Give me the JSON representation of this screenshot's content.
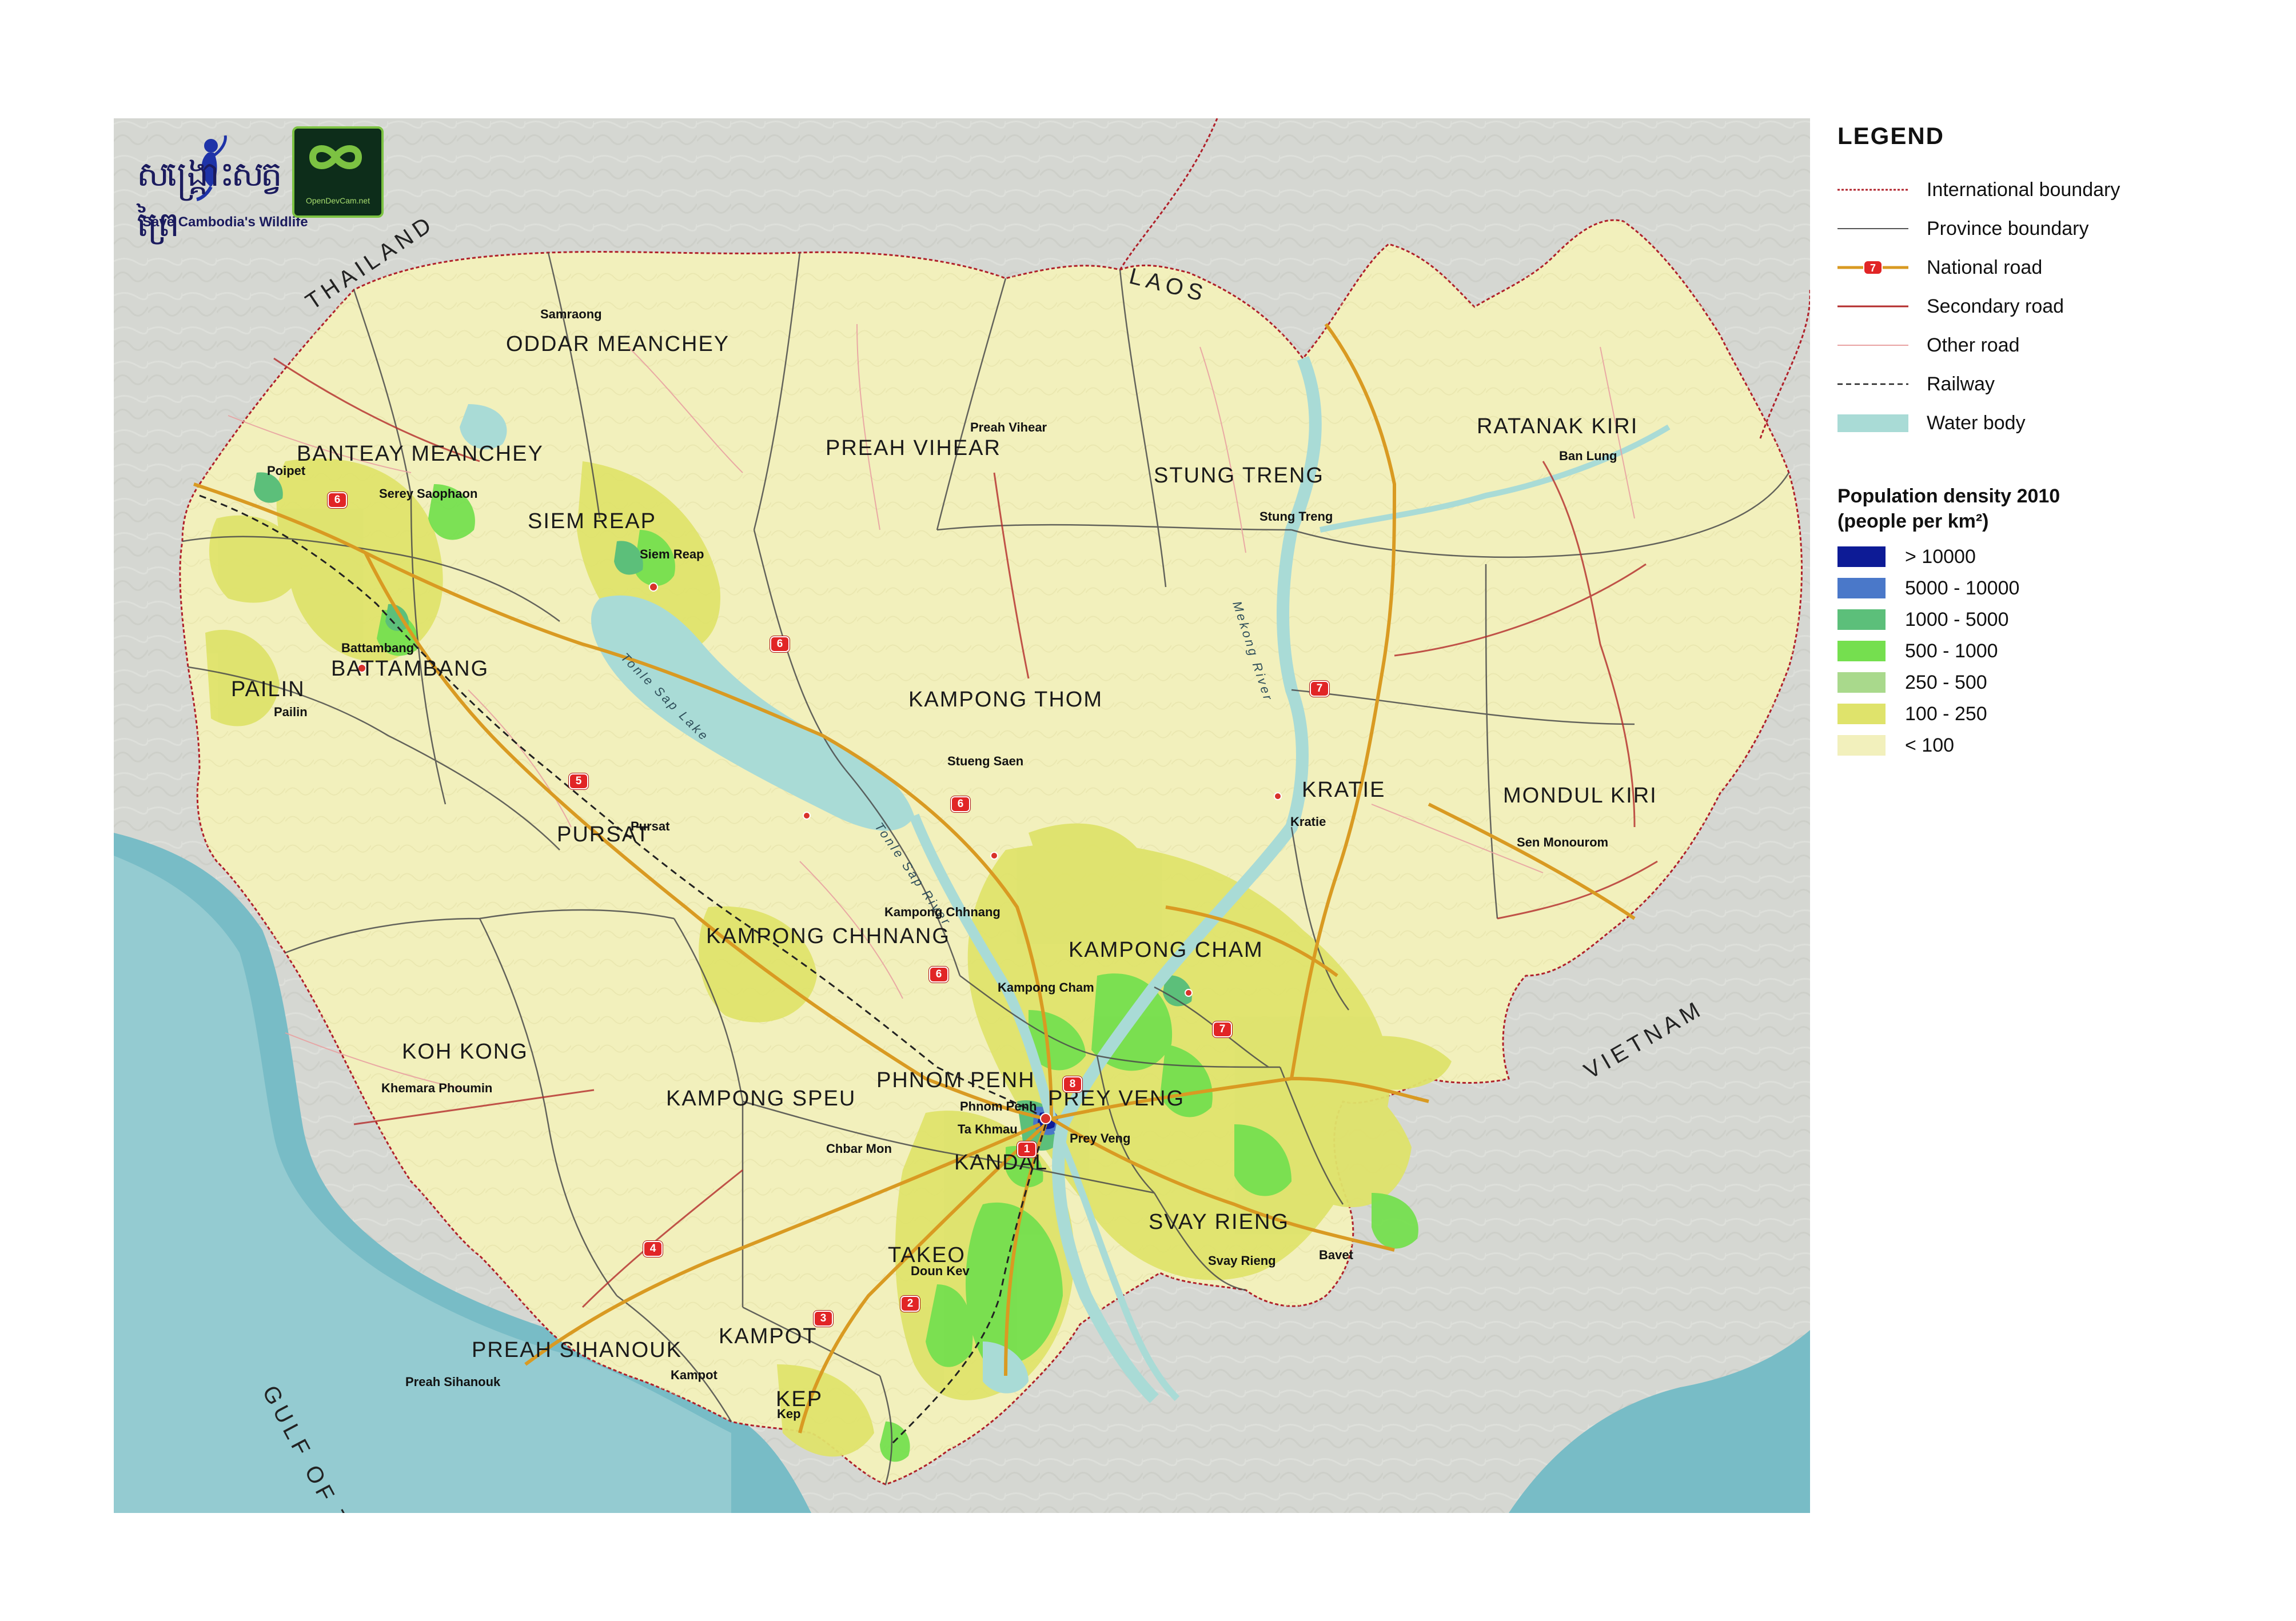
{
  "logos": {
    "wildlife_caption": "Save Cambodia's Wildlife",
    "wildlife_khmer": "សង្គ្រោះសត្វព្រៃ",
    "odc_caption": "OpenDevCam.net"
  },
  "countries": {
    "thailand": "THAILAND",
    "laos": "LAOS",
    "vietnam": "VIETNAM",
    "gulf": "GULF OF THAILAND"
  },
  "water_labels": {
    "tonle_sap_lake": "Tonle Sap Lake",
    "tonle_sap_river": "Tonle Sap River",
    "mekong": "Mekong River"
  },
  "provinces": {
    "oddar_meanchey": "ODDAR MEANCHEY",
    "banteay_meanchey": "BANTEAY MEANCHEY",
    "siem_reap": "SIEM REAP",
    "preah_vihear": "PREAH VIHEAR",
    "stung_treng": "STUNG TRENG",
    "ratanak_kiri": "RATANAK KIRI",
    "pailin": "PAILIN",
    "battambang": "BATTAMBANG",
    "kampong_thom": "KAMPONG THOM",
    "kratie": "KRATIE",
    "mondul_kiri": "MONDUL KIRI",
    "pursat": "PURSAT",
    "kampong_chhnang": "KAMPONG CHHNANG",
    "kampong_cham": "KAMPONG CHAM",
    "koh_kong": "KOH KONG",
    "kampong_speu": "KAMPONG SPEU",
    "phnom_penh": "PHNOM PENH",
    "prey_veng": "PREY VENG",
    "kandal": "KANDAL",
    "svay_rieng": "SVAY RIENG",
    "takeo": "TAKEO",
    "preah_sihanouk": "PREAH SIHANOUK",
    "kampot": "KAMPOT",
    "kep": "KEP"
  },
  "towns": {
    "samraong": "Samraong",
    "poipet": "Poipet",
    "serey_saophoan": "Serey Saophaon",
    "siem_reap": "Siem Reap",
    "preah_vihear": "Preah Vihear",
    "ban_lung": "Ban Lung",
    "stung_treng": "Stung Treng",
    "battambang": "Battambang",
    "pailin": "Pailin",
    "stueng_saen": "Stueng Saen",
    "kratie": "Kratie",
    "sen_monourom": "Sen Monourom",
    "pursat": "Pursat",
    "kampong_chhnang": "Kampong Chhnang",
    "kampong_cham": "Kampong Cham",
    "khemara_phoumin": "Khemara Phoumin",
    "phnom_penh": "Phnom Penh",
    "ta_khmau": "Ta Khmau",
    "chbar_mon": "Chbar Mon",
    "prey_veng": "Prey Veng",
    "svay_rieng": "Svay Rieng",
    "bavet": "Bavet",
    "doun_kev": "Doun Kev",
    "preah_sihanouk": "Preah Sihanouk",
    "kampot": "Kampot",
    "kep": "Kep"
  },
  "roads": [
    "6",
    "6",
    "5",
    "6",
    "6",
    "7",
    "7",
    "8",
    "1",
    "2",
    "3",
    "4"
  ],
  "legend": {
    "title": "LEGEND",
    "items": [
      {
        "label": "International boundary",
        "symbol": "dotted-red-line"
      },
      {
        "label": "Province boundary",
        "symbol": "thin-grey-line"
      },
      {
        "label": "National road",
        "symbol": "orange-road-with-shield",
        "shield": "7"
      },
      {
        "label": "Secondary road",
        "symbol": "dark-red-line"
      },
      {
        "label": "Other road",
        "symbol": "thin-pink-line"
      },
      {
        "label": "Railway",
        "symbol": "dashed-black-line"
      },
      {
        "label": "Water body",
        "symbol": "cyan-fill"
      }
    ],
    "density_title": "Population density 2010",
    "density_unit": "(people per km²)",
    "density_classes": [
      {
        "label": "> 10000",
        "color": "#0d1b96"
      },
      {
        "label": "5000 - 10000",
        "color": "#4a78c9"
      },
      {
        "label": "1000 - 5000",
        "color": "#5cbf7a"
      },
      {
        "label": "500 - 1000",
        "color": "#75df4f"
      },
      {
        "label": "250 - 500",
        "color": "#a9d98c"
      },
      {
        "label": "100 - 250",
        "color": "#dfe36b"
      },
      {
        "label": "< 100",
        "color": "#f2f0bc"
      }
    ]
  },
  "colors": {
    "sea": "#78bcc6",
    "land_outside": "#d5d7d2",
    "cambodia_base": "#f2f0bc",
    "water_body": "#a9dbd6",
    "national_road": "#d99a22",
    "secondary_road": "#b32b2b",
    "other_road": "#e8a1a1",
    "province_boundary": "#4a4a4a",
    "international_boundary": "#b0202a"
  }
}
